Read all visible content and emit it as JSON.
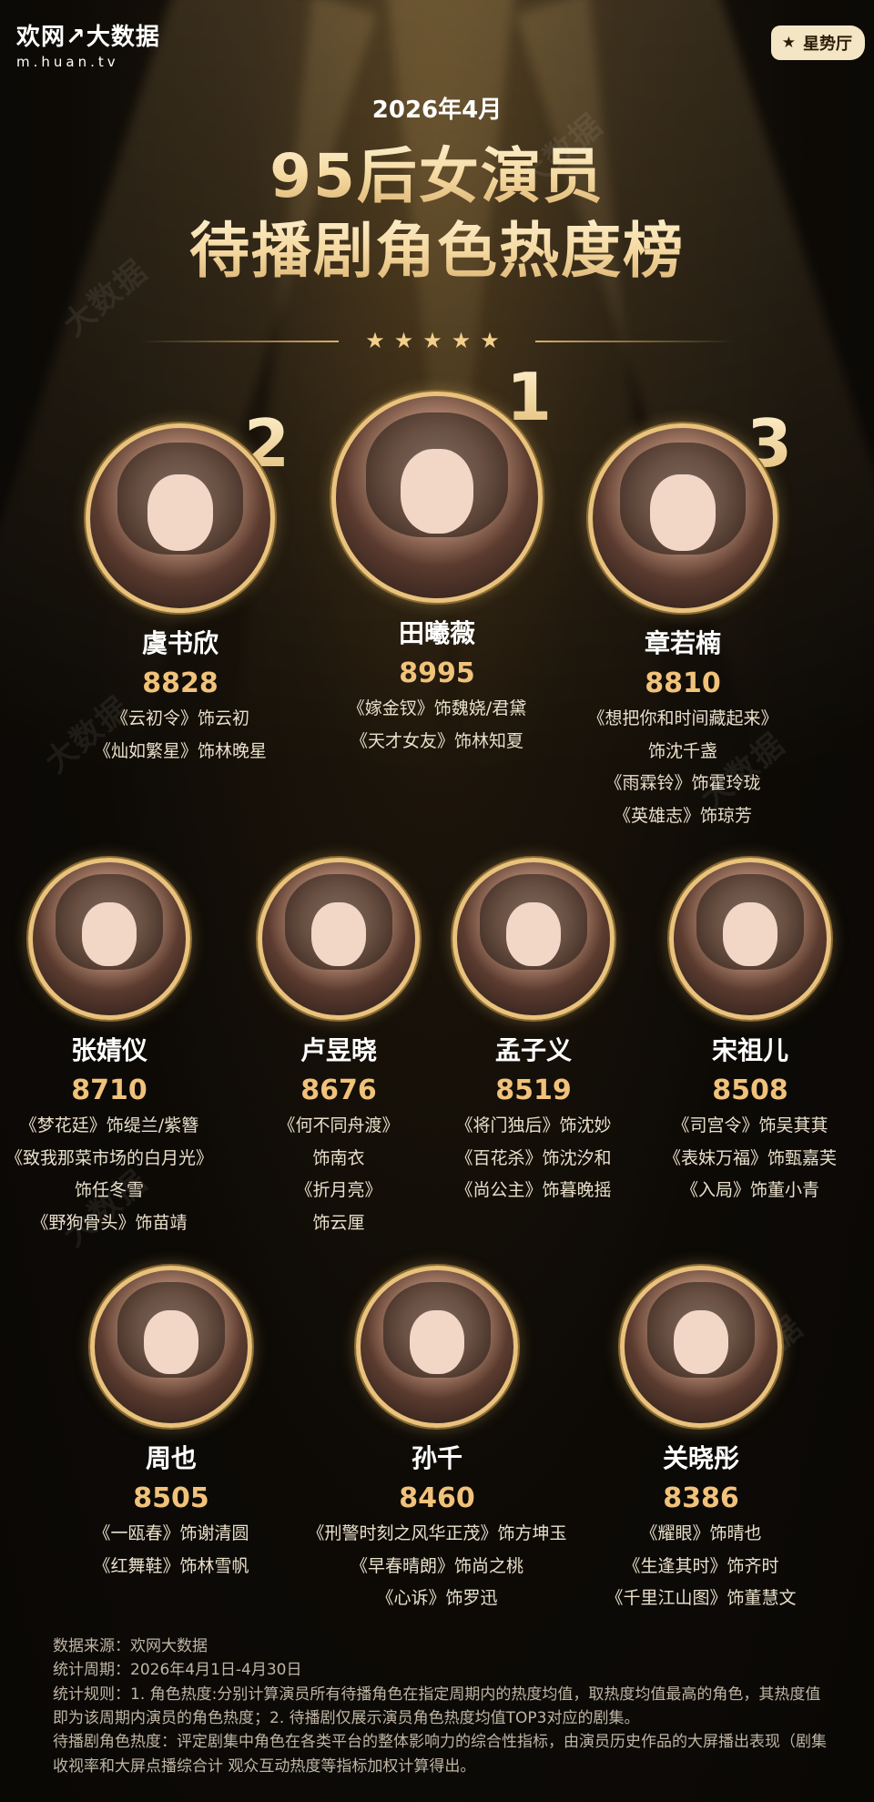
{
  "brand": {
    "logo_text_a": "欢网",
    "logo_sep": "↗",
    "logo_text_b": "大数据",
    "domain": "m.huan.tv"
  },
  "badge": {
    "icon": "star-icon",
    "label": "星势厅"
  },
  "header": {
    "date": "2026年4月",
    "title_line1": "95后女演员",
    "title_line2": "待播剧角色热度榜",
    "stars": "★★★★★"
  },
  "top3": [
    {
      "rank": "1",
      "name": "田曦薇",
      "score": "8995",
      "roles": [
        "《嫁金钗》饰魏娆/君黛",
        "《天才女友》饰林知夏"
      ]
    },
    {
      "rank": "2",
      "name": "虞书欣",
      "score": "8828",
      "roles": [
        "《云初令》饰云初",
        "《灿如繁星》饰林晚星"
      ]
    },
    {
      "rank": "3",
      "name": "章若楠",
      "score": "8810",
      "roles": [
        "《想把你和时间藏起来》",
        "饰沈千盏",
        "《雨霖铃》饰霍玲珑",
        "《英雄志》饰琼芳"
      ]
    }
  ],
  "row2": [
    {
      "name": "张婧仪",
      "score": "8710",
      "roles": [
        "《梦花廷》饰缇兰/紫簪",
        "《致我那菜市场的白月光》",
        "饰任冬雪",
        "《野狗骨头》饰苗靖"
      ]
    },
    {
      "name": "卢昱晓",
      "score": "8676",
      "roles": [
        "《何不同舟渡》",
        "饰南衣",
        "《折月亮》",
        "饰云厘"
      ]
    },
    {
      "name": "孟子义",
      "score": "8519",
      "roles": [
        "《将门独后》饰沈妙",
        "《百花杀》饰沈汐和",
        "《尚公主》饰暮晚摇"
      ]
    },
    {
      "name": "宋祖儿",
      "score": "8508",
      "roles": [
        "《司宫令》饰吴萁萁",
        "《表妹万福》饰甄嘉芙",
        "《入局》饰董小青"
      ]
    }
  ],
  "row3": [
    {
      "name": "周也",
      "score": "8505",
      "roles": [
        "《一瓯春》饰谢清圆",
        "《红舞鞋》饰林雪帆"
      ]
    },
    {
      "name": "孙千",
      "score": "8460",
      "roles": [
        "《刑警时刻之风华正茂》饰方坤玉",
        "《早春晴朗》饰尚之桃",
        "《心诉》饰罗迅"
      ]
    },
    {
      "name": "关晓彤",
      "score": "8386",
      "roles": [
        "《耀眼》饰晴也",
        "《生逢其时》饰齐时",
        "《千里江山图》饰董慧文"
      ]
    }
  ],
  "footer": {
    "source": "数据来源：欢网大数据",
    "period": "统计周期：2026年4月1日-4月30日",
    "rule": "统计规则：1. 角色热度:分别计算演员所有待播角色在指定周期内的热度均值，取热度均值最高的角色，其热度值即为该周期内演员的角色热度；2. 待播剧仅展示演员角色热度均值TOP3对应的剧集。",
    "definition": "待播剧角色热度：评定剧集中角色在各类平台的整体影响力的综合性指标，由演员历史作品的大屏播出表现（剧集收视率和大屏点播综合计 观众互动热度等指标加权计算得出。"
  }
}
